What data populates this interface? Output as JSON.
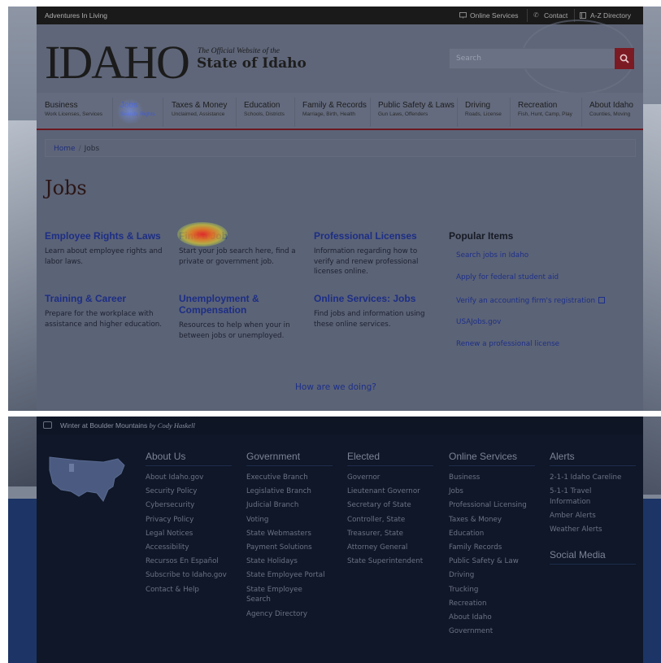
{
  "topbar": {
    "tagline": "Adventures In Living",
    "online_services": "Online Services",
    "contact": "Contact",
    "az_directory": "A-Z Directory"
  },
  "header": {
    "logo": "IDAHO",
    "logo_sub_line1": "The Official Website of the",
    "logo_sub_line2": "State of Idaho",
    "search_placeholder": "Search"
  },
  "nav": [
    {
      "label": "Business",
      "sub": "Work Licenses, Services"
    },
    {
      "label": "Jobs",
      "sub": "Search, Rights"
    },
    {
      "label": "Taxes & Money",
      "sub": "Unclaimed, Assistance"
    },
    {
      "label": "Education",
      "sub": "Schools, Districts"
    },
    {
      "label": "Family & Records",
      "sub": "Marriage, Birth, Health"
    },
    {
      "label": "Public Safety & Laws",
      "sub": "Gun Laws, Offenders"
    },
    {
      "label": "Driving",
      "sub": "Roads, License"
    },
    {
      "label": "Recreation",
      "sub": "Fish, Hunt, Camp, Play"
    },
    {
      "label": "About Idaho",
      "sub": "Counties, Moving"
    }
  ],
  "breadcrumb": {
    "home": "Home",
    "separator": "/",
    "current": "Jobs"
  },
  "page_title": "Jobs",
  "cards": [
    {
      "title": "Employee Rights & Laws",
      "desc": "Learn about employee rights and labor laws."
    },
    {
      "title": "Find a Job",
      "desc": "Start your job search here, find a private or government job."
    },
    {
      "title": "Professional Licenses",
      "desc": "Information regarding how to verify and renew professional licenses online."
    },
    {
      "title": "Training & Career",
      "desc": "Prepare for the workplace with assistance and higher education."
    },
    {
      "title": "Unemployment & Compensation",
      "desc": "Resources to help when your in between jobs or unemployed."
    },
    {
      "title": "Online Services: Jobs",
      "desc": "Find jobs and information using these online services."
    }
  ],
  "popular": {
    "heading": "Popular Items",
    "items": [
      "Search jobs in Idaho",
      "Apply for federal student aid",
      "Verify an accounting firm's registration",
      "USAJobs.gov",
      "Renew a professional license"
    ]
  },
  "feedback": "How are we doing?",
  "caption": {
    "text": "Winter at Boulder Mountains",
    "credit": "by Cody Haskell"
  },
  "footer": {
    "about": {
      "heading": "About Us",
      "links": [
        "About Idaho.gov",
        "Security Policy",
        "Cybersecurity",
        "Privacy Policy",
        "Legal Notices",
        "Accessibility",
        "Recursos En Español",
        "Subscribe to Idaho.gov",
        "Contact & Help"
      ]
    },
    "government": {
      "heading": "Government",
      "links": [
        "Executive Branch",
        "Legislative Branch",
        "Judicial Branch",
        "Voting",
        "State Webmasters",
        "Payment Solutions",
        "State Holidays",
        "State Employee Portal",
        "State Employee Search",
        "Agency Directory"
      ]
    },
    "elected": {
      "heading": "Elected",
      "links": [
        "Governor",
        "Lieutenant Governor",
        "Secretary of State",
        "Controller, State",
        "Treasurer, State",
        "Attorney General",
        "State Superintendent"
      ]
    },
    "online": {
      "heading": "Online Services",
      "links": [
        "Business",
        "Jobs",
        "Professional Licensing",
        "Taxes & Money",
        "Education",
        "Family Records",
        "Public Safety & Law",
        "Driving",
        "Trucking",
        "Recreation",
        "About Idaho",
        "Government"
      ]
    },
    "alerts": {
      "heading": "Alerts",
      "links": [
        "2-1-1 Idaho Careline",
        "5-1-1 Travel Information",
        "Amber Alerts",
        "Weather Alerts"
      ]
    },
    "social_heading": "Social Media"
  },
  "colors": {
    "accent_red": "#7c1a23",
    "link_blue": "#1d2f8a",
    "footer_bg": "#0f1728"
  }
}
